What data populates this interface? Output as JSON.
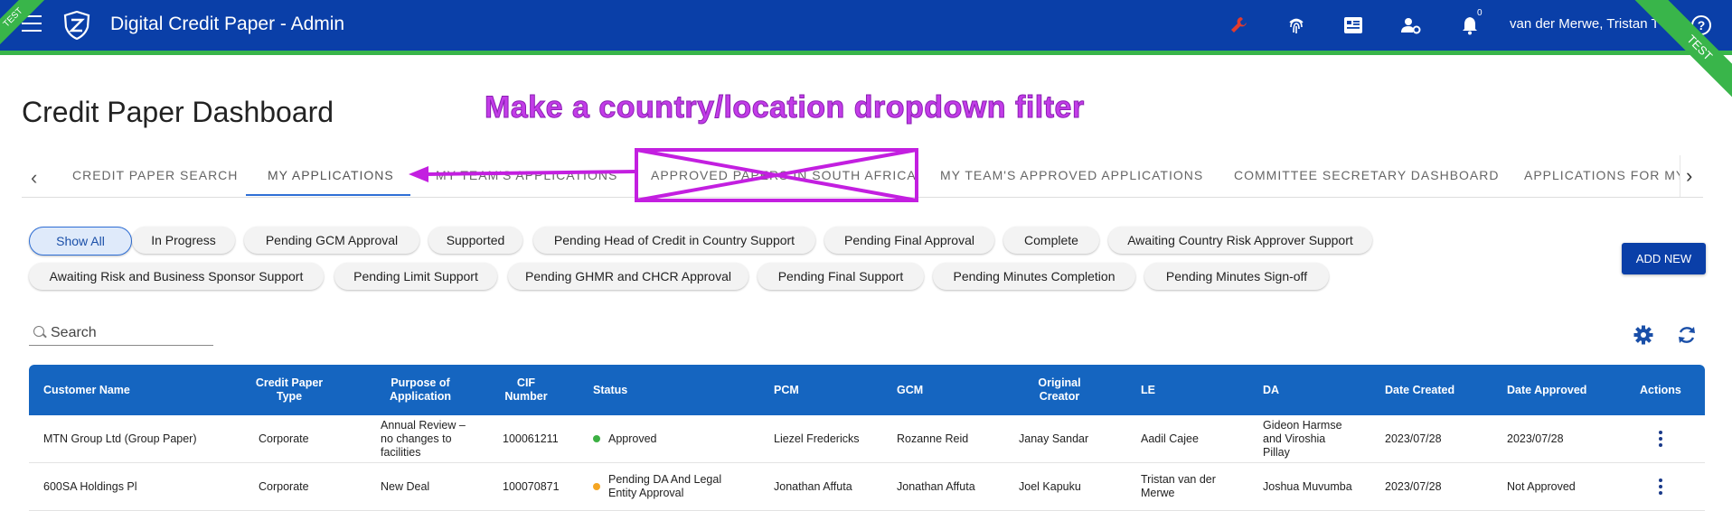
{
  "ribbon": {
    "left": "TEST",
    "right": "TEST"
  },
  "app": {
    "title": "Digital Credit Paper - Admin",
    "notification_count": "0",
    "user_name": "van der Merwe, Tristan T"
  },
  "header_icons": [
    "wrench-icon",
    "fingerprint-icon",
    "report-card-icon",
    "user-settings-icon",
    "bell-icon",
    "help-icon"
  ],
  "colors": {
    "topbar": "#0a3fa8",
    "accent_green": "#39b54a",
    "table_header": "#1565c0",
    "annotation": "#c33ce8",
    "wrench": "#e03b2f"
  },
  "page": {
    "title": "Credit Paper Dashboard"
  },
  "annotation": {
    "text": "Make a country/location dropdown filter"
  },
  "tabs": [
    {
      "label": "CREDIT PAPER SEARCH"
    },
    {
      "label": "MY APPLICATIONS"
    },
    {
      "label": "MY TEAM'S APPLICATIONS"
    },
    {
      "label": "APPROVED PAPERS IN SOUTH AFRICA"
    },
    {
      "label": "MY TEAM'S APPROVED APPLICATIONS"
    },
    {
      "label": "COMMITTEE SECRETARY DASHBOARD"
    },
    {
      "label": "APPLICATIONS FOR MY R"
    }
  ],
  "active_tab": "MY APPLICATIONS",
  "filters": [
    "Show All",
    "In Progress",
    "Pending GCM Approval",
    "Supported",
    "Pending Head of Credit in Country Support",
    "Pending Final Approval",
    "Complete",
    "Awaiting Country Risk Approver Support",
    "Awaiting Risk and Business Sponsor Support",
    "Pending Limit Support",
    "Pending GHMR and CHCR Approval",
    "Pending Final Support",
    "Pending Minutes Completion",
    "Pending Minutes Sign-off"
  ],
  "selected_filter": "Show All",
  "add_new_label": "ADD NEW",
  "search": {
    "placeholder": "Search"
  },
  "table": {
    "columns": [
      "Customer Name",
      "Credit Paper Type",
      "Purpose of Application",
      "CIF Number",
      "Status",
      "PCM",
      "GCM",
      "Original Creator",
      "LE",
      "DA",
      "Date Created",
      "Date Approved",
      "Actions"
    ],
    "rows": [
      {
        "customer": "MTN Group Ltd (Group Paper)",
        "type": "Corporate",
        "purpose": "Annual Review – no changes to facilities",
        "cif": "100061211",
        "status": "Approved",
        "status_color": "#3cb043",
        "pcm": "Liezel Fredericks",
        "gcm": "Rozanne Reid",
        "creator": "Janay Sandar",
        "le": "Aadil Cajee",
        "da": "Gideon Harmse and Viroshia Pillay",
        "created": "2023/07/28",
        "approved": "2023/07/28"
      },
      {
        "customer": "600SA Holdings Pl",
        "type": "Corporate",
        "purpose": "New Deal",
        "cif": "100070871",
        "status": "Pending DA And Legal Entity Approval",
        "status_color": "#f5a623",
        "pcm": "Jonathan Affuta",
        "gcm": "Jonathan Affuta",
        "creator": "Joel Kapuku",
        "le": "Tristan van der Merwe",
        "da": "Joshua Muvumba",
        "created": "2023/07/28",
        "approved": "Not Approved"
      }
    ]
  }
}
